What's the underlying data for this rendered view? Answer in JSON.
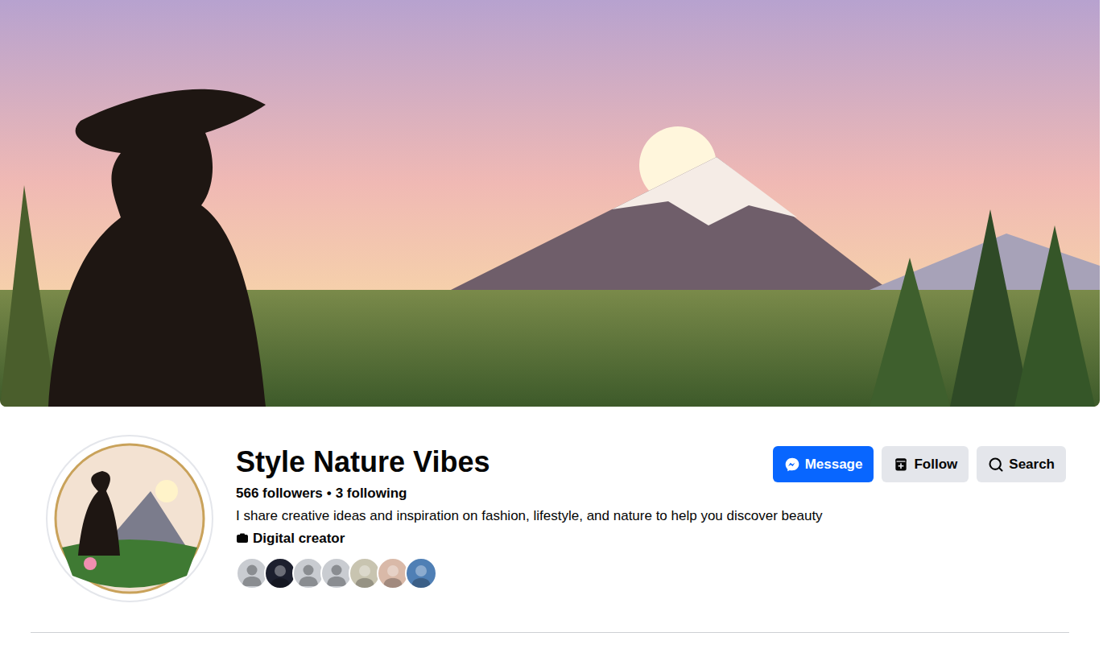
{
  "page": {
    "name": "Style Nature Vibes",
    "followers": "566 followers",
    "separator": "•",
    "following": "3 following",
    "bio": "I share creative ideas and inspiration on fashion, lifestyle, and nature to help you discover beauty",
    "category": "Digital creator"
  },
  "buttons": [
    {
      "label": "Message",
      "kind": "primary"
    },
    {
      "label": "Follow",
      "kind": "secondary"
    },
    {
      "label": "Search",
      "kind": "secondary"
    }
  ],
  "follower_avatars": [
    {
      "kind": "default",
      "color": "#c9ccd1"
    },
    {
      "kind": "photo",
      "color": "#1c1f2e"
    },
    {
      "kind": "default",
      "color": "#c9ccd1"
    },
    {
      "kind": "default",
      "color": "#c9ccd1"
    },
    {
      "kind": "photo",
      "color": "#c8c4b0"
    },
    {
      "kind": "photo",
      "color": "#d9b9a8"
    },
    {
      "kind": "photo",
      "color": "#4f7fb5"
    }
  ]
}
